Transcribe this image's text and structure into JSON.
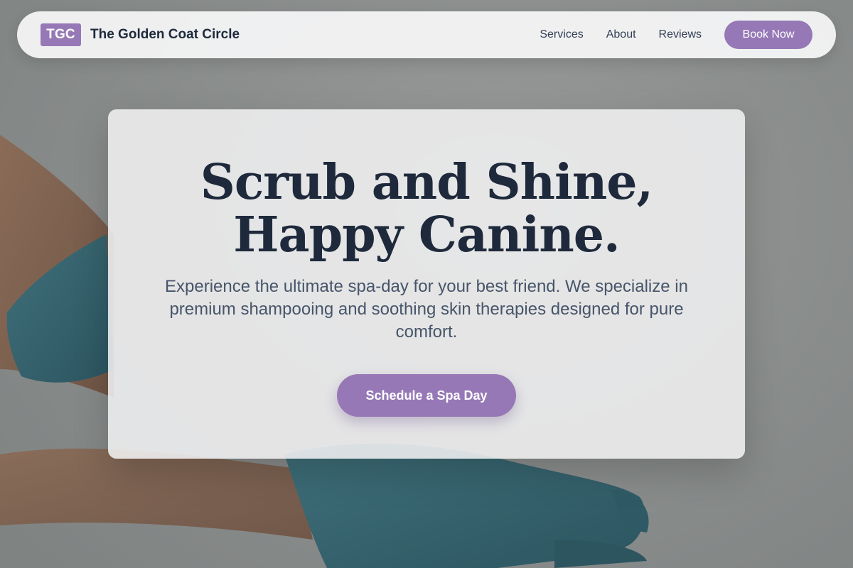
{
  "header": {
    "logo_badge": "TGC",
    "brand_name": "The Golden Coat Circle",
    "nav_items": [
      {
        "label": "Services"
      },
      {
        "label": "About"
      },
      {
        "label": "Reviews"
      }
    ],
    "cta_label": "Book Now"
  },
  "hero": {
    "title_line_1": "Scrub and Shine,",
    "title_line_2": "Happy Canine.",
    "subtitle": "Experience the ultimate spa-day for your best friend. We specialize in premium shampooing and soothing skin therapies designed for pure comfort.",
    "cta_label": "Schedule a Spa Day"
  },
  "colors": {
    "accent": "#9678b6",
    "heading": "#1e293b",
    "body_text": "#475569",
    "nav_text": "#334155"
  }
}
